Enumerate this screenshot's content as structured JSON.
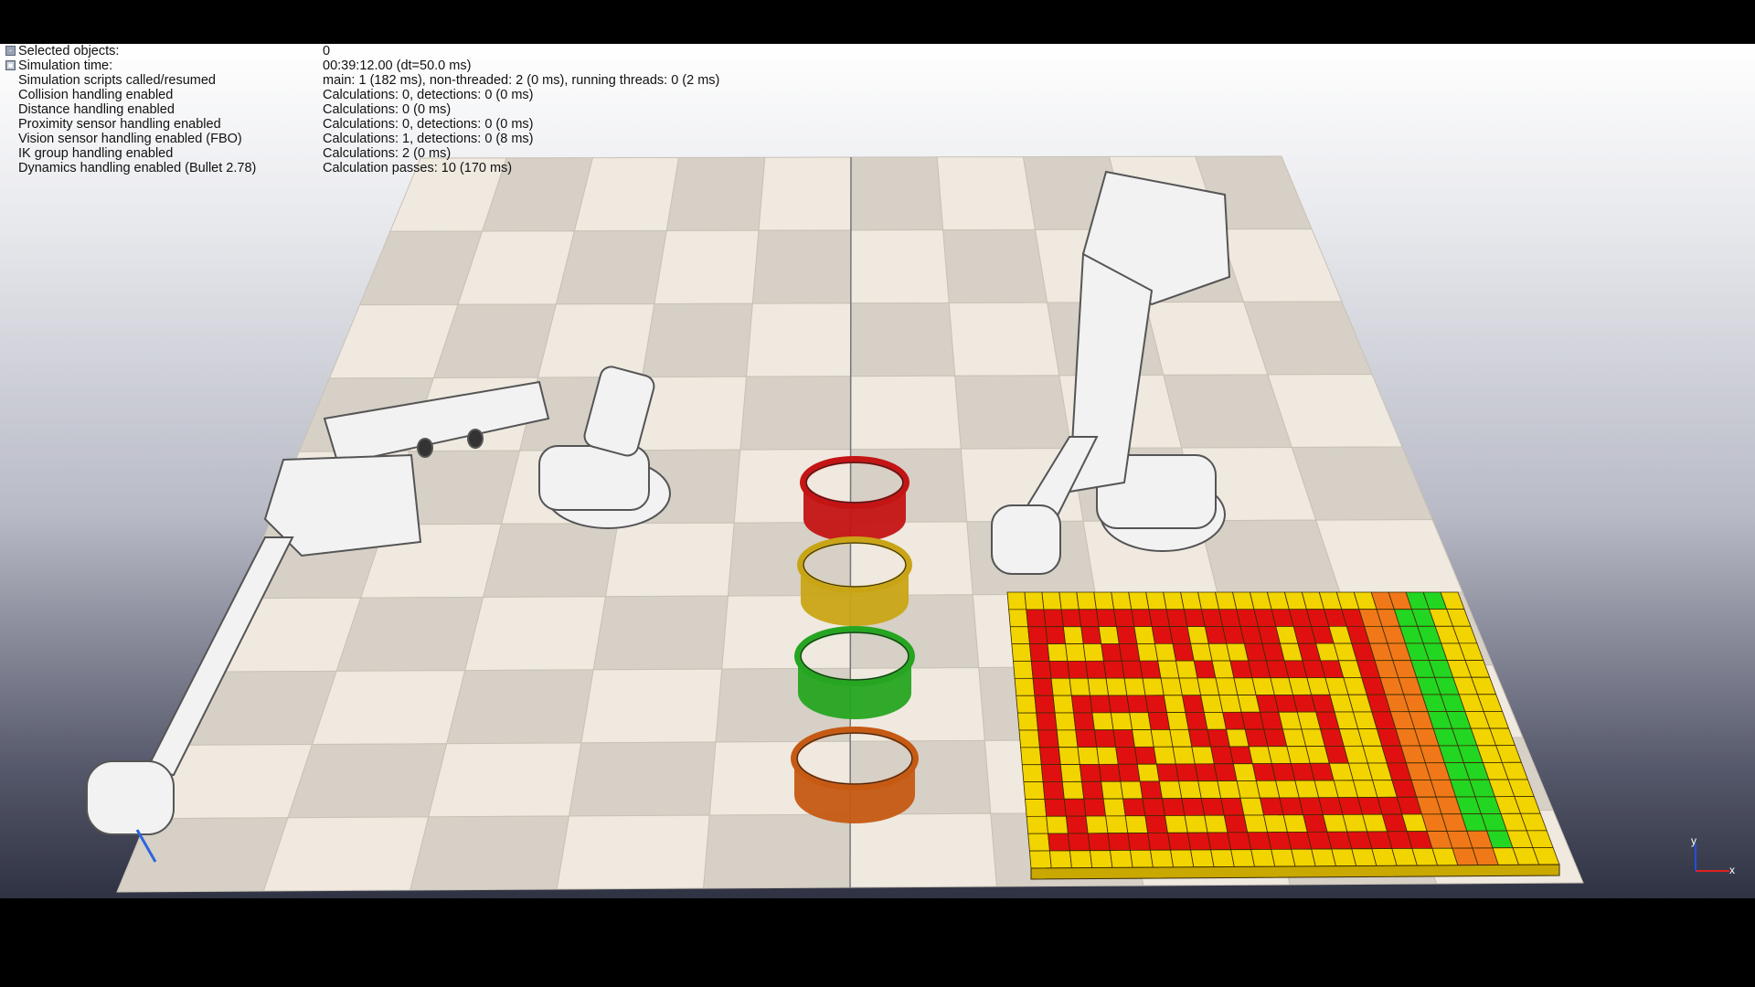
{
  "info_panel": {
    "rows": [
      {
        "label": "Selected objects:",
        "value": "0",
        "toggle": "-"
      },
      {
        "label": "Simulation time:",
        "value": "00:39:12.00 (dt=50.0 ms)",
        "toggle": "▣"
      },
      {
        "label": "Simulation scripts called/resumed",
        "value": "main: 1 (182 ms), non-threaded: 2 (0 ms), running threads: 0 (2 ms)"
      },
      {
        "label": "Collision handling enabled",
        "value": "Calculations: 0, detections: 0 (0 ms)"
      },
      {
        "label": "Distance handling enabled",
        "value": "Calculations: 0 (0 ms)"
      },
      {
        "label": "Proximity sensor handling enabled",
        "value": "Calculations: 0, detections: 0 (0 ms)"
      },
      {
        "label": "Vision sensor handling enabled (FBO)",
        "value": "Calculations: 1, detections: 0 (8 ms)"
      },
      {
        "label": "IK group handling enabled",
        "value": "Calculations: 2 (0 ms)"
      },
      {
        "label": "Dynamics handling enabled (Bullet 2.78)",
        "value": "Calculation passes: 10 (170 ms)"
      }
    ]
  },
  "scene": {
    "floor_colors": {
      "light": "#efe9e0",
      "dark": "#d6d0c6"
    },
    "rings": [
      {
        "color": "#c41414"
      },
      {
        "color": "#c9a516"
      },
      {
        "color": "#26a521"
      },
      {
        "color": "#c65a13"
      }
    ],
    "cube_colors": {
      "red": "#e01010",
      "yellow": "#f2d400",
      "orange": "#f07818",
      "green": "#22d622"
    },
    "robots": [
      "robot-arm-left",
      "robot-arm-right"
    ]
  },
  "axis_gizmo": {
    "x_label": "x",
    "y_label": "y"
  }
}
